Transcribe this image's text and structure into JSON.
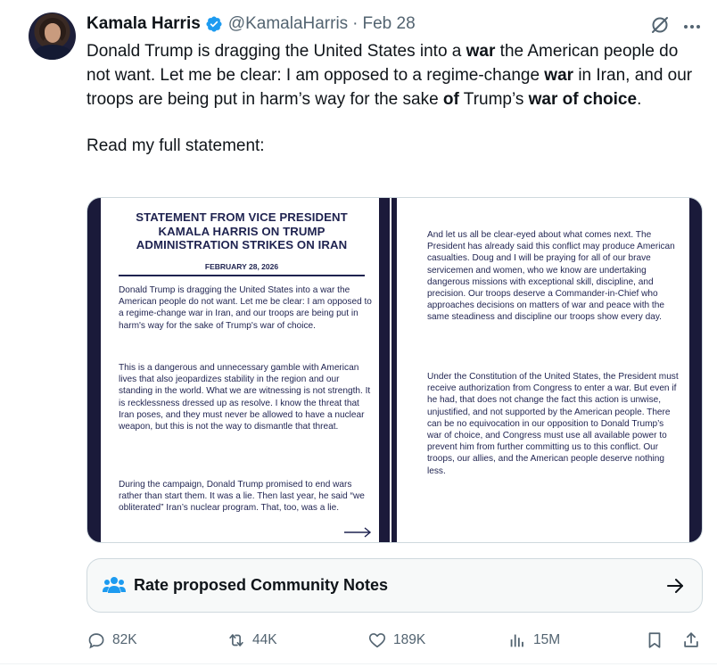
{
  "author": {
    "name": "Kamala Harris",
    "handle": "@KamalaHarris",
    "separator": "·",
    "date": "Feb 28"
  },
  "tweet": {
    "line1_pre": "Donald Trump is dragging the United States into a ",
    "line1_bold": "war",
    "line1_post": " the American people do not want. Let me be clear: I am opposed to a regime-change ",
    "line2_bold": "war",
    "line2_post": " in Iran, and our troops are being put in harm’s way for the sake ",
    "line3_bold": "of",
    "line3_mid": " Trump’s ",
    "line3_bold2": "war of choice",
    "line3_end": ".",
    "read_more": "Read my full statement:"
  },
  "statement": {
    "title": "STATEMENT FROM VICE PRESIDENT KAMALA HARRIS ON TRUMP ADMINISTRATION STRIKES ON IRAN",
    "date": "FEBRUARY 28, 2026",
    "left_paragraphs": [
      "Donald Trump is dragging the United States into a war the American people do not want. Let me be clear: I am opposed to a regime-change war in Iran, and our troops are being put in harm's way for the sake of Trump's war of choice.",
      "This is a dangerous and unnecessary gamble with American lives that also jeopardizes stability in the region and our standing in the world. What we are witnessing is not strength. It is recklessness dressed up as resolve. I know the threat that Iran poses, and they must never be allowed to have a nuclear weapon, but this is not the way to dismantle that threat.",
      "During the campaign, Donald Trump promised to end wars rather than start them. It was a lie. Then last year, he said “we obliterated” Iran’s nuclear program. That, too, was a lie."
    ],
    "right_paragraphs": [
      "And let us all be clear-eyed about what comes next. The President has already said this conflict may produce American casualties. Doug and I will be praying for all of our brave servicemen and women, who we know are undertaking dangerous missions with exceptional skill, discipline, and precision. Our troops deserve a Commander-in-Chief who approaches decisions on matters of war and peace with the same steadiness and discipline our troops show every day.",
      "Under the Constitution of the United States, the President must receive authorization from Congress to enter a war. But even if he had, that does not change the fact this action is unwise, unjustified, and not supported by the American people. There can be no equivocation in our opposition to Donald Trump’s war of choice, and Congress must use all available power to prevent him from further committing us to this conflict. Our troops, our allies, and the American people deserve nothing less."
    ]
  },
  "community_notes": {
    "label": "Rate proposed Community Notes",
    "icon": "people-icon"
  },
  "actions": {
    "replies": "82K",
    "reposts": "44K",
    "likes": "189K",
    "views": "15M"
  },
  "colors": {
    "verified": "#1d9bf0",
    "muted": "#536471",
    "text": "#0f1419",
    "doc_navy": "#1f2350",
    "notes_icon": "#1d9bf0"
  }
}
